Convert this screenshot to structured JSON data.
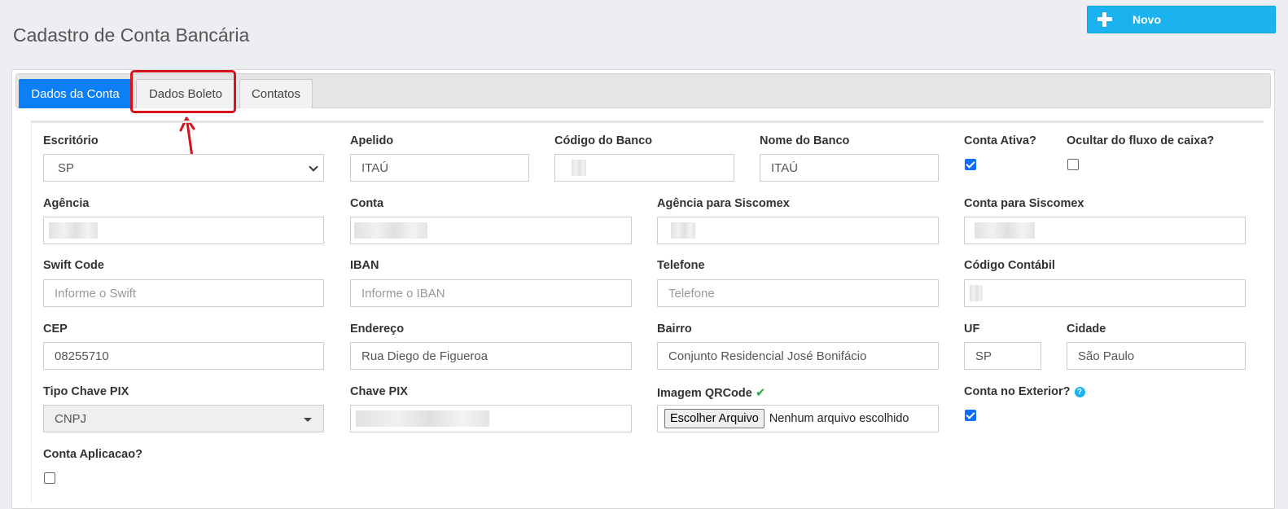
{
  "page": {
    "title": "Cadastro de Conta Bancária",
    "new_button_label": "Novo"
  },
  "tabs": [
    {
      "label": "Dados da Conta",
      "active": true
    },
    {
      "label": "Dados Boleto",
      "active": false
    },
    {
      "label": "Contatos",
      "active": false
    }
  ],
  "form": {
    "escritorio": {
      "label": "Escritório",
      "value": "SP"
    },
    "apelido": {
      "label": "Apelido",
      "value": "ITAÚ"
    },
    "codigo_banco": {
      "label": "Código do Banco",
      "value": ""
    },
    "nome_banco": {
      "label": "Nome do Banco",
      "value": "ITAÚ"
    },
    "conta_ativa": {
      "label": "Conta Ativa?",
      "checked": true
    },
    "ocultar_fluxo": {
      "label": "Ocultar do fluxo de caixa?",
      "checked": false
    },
    "agencia": {
      "label": "Agência",
      "value": ""
    },
    "conta": {
      "label": "Conta",
      "value": ""
    },
    "agencia_siscomex": {
      "label": "Agência para Siscomex",
      "value": ""
    },
    "conta_siscomex": {
      "label": "Conta para Siscomex",
      "value": ""
    },
    "swift": {
      "label": "Swift Code",
      "placeholder": "Informe o Swift"
    },
    "iban": {
      "label": "IBAN",
      "placeholder": "Informe o IBAN"
    },
    "telefone": {
      "label": "Telefone",
      "placeholder": "Telefone"
    },
    "codigo_contabil": {
      "label": "Código Contábil",
      "value": ""
    },
    "cep": {
      "label": "CEP",
      "value": "08255710"
    },
    "endereco": {
      "label": "Endereço",
      "value": "Rua Diego de Figueroa"
    },
    "bairro": {
      "label": "Bairro",
      "value": "Conjunto Residencial José Bonifácio"
    },
    "uf": {
      "label": "UF",
      "value": "SP"
    },
    "cidade": {
      "label": "Cidade",
      "value": "São Paulo"
    },
    "tipo_chave_pix": {
      "label": "Tipo Chave PIX",
      "value": "CNPJ"
    },
    "chave_pix": {
      "label": "Chave PIX",
      "value": ""
    },
    "imagem_qrcode": {
      "label": "Imagem QRCode",
      "button_label": "Escolher Arquivo",
      "status": "Nenhum arquivo escolhido"
    },
    "conta_exterior": {
      "label": "Conta no Exterior?",
      "checked": true
    },
    "conta_aplicacao": {
      "label": "Conta Aplicacao?",
      "checked": false
    }
  },
  "colors": {
    "active_tab": "#0d7ff5",
    "new_button": "#1ab3f0",
    "annotation": "#d6131b",
    "checkbox_on": "#0d6efd"
  },
  "icons": {
    "new_button": "plus-icon",
    "escritorio_dropdown": "chevron-down-icon",
    "tipo_chave_dropdown": "caret-down-icon",
    "qrcode_ok": "check-icon",
    "conta_exterior_help": "question-circle-icon"
  }
}
